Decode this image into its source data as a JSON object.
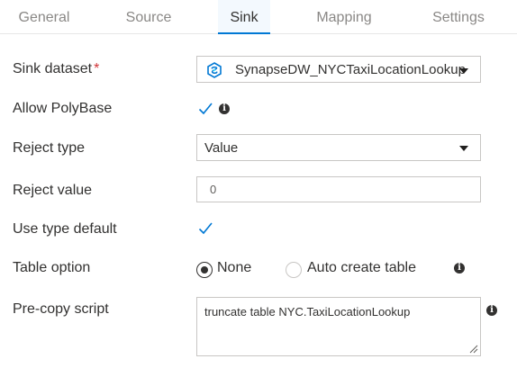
{
  "tabs": [
    {
      "label": "General"
    },
    {
      "label": "Source"
    },
    {
      "label": "Sink"
    },
    {
      "label": "Mapping"
    },
    {
      "label": "Settings"
    }
  ],
  "active_tab": "Sink",
  "form": {
    "sink_dataset": {
      "label": "Sink dataset",
      "required_mark": "*",
      "value": "SynapseDW_NYCTaxiLocationLookup"
    },
    "allow_polybase": {
      "label": "Allow PolyBase",
      "checked": true
    },
    "reject_type": {
      "label": "Reject type",
      "value": "Value"
    },
    "reject_value": {
      "label": "Reject value",
      "value": "0"
    },
    "use_type_default": {
      "label": "Use type default",
      "checked": true
    },
    "table_option": {
      "label": "Table option",
      "options": [
        "None",
        "Auto create table"
      ],
      "selected": "None"
    },
    "pre_copy_script": {
      "label": "Pre-copy script",
      "value": "truncate table NYC.TaxiLocationLookup"
    }
  },
  "colors": {
    "accent": "#0078d4",
    "text": "#323130",
    "muted": "#8a8886",
    "border": "#c8c6c4",
    "required": "#d13438"
  },
  "icons": {
    "dataset": "synapse-dataset-icon",
    "info": "info-icon",
    "check": "checkmark-icon",
    "dropdown": "chevron-down-icon"
  }
}
